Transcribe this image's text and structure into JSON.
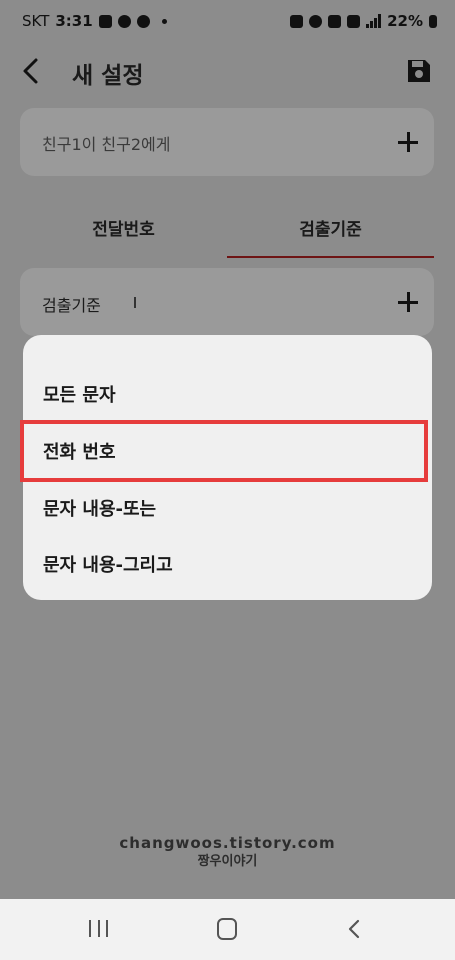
{
  "status_bar": {
    "carrier": "SKT",
    "time": "3:31",
    "battery": "22%"
  },
  "app_bar": {
    "title": "새 설정",
    "back_icon": "chevron-left-icon",
    "save_icon": "floppy-disk-icon"
  },
  "recipient": {
    "text": "친구1이 친구2에게",
    "add_icon": "plus-icon"
  },
  "tabs": [
    {
      "label": "전달번호",
      "active": false
    },
    {
      "label": "검출기준",
      "active": true
    }
  ],
  "criteria": {
    "label": "검출기준",
    "add_icon": "plus-icon"
  },
  "menu": {
    "items": [
      {
        "label": "모든 문자"
      },
      {
        "label": "전화 번호",
        "highlighted": true
      },
      {
        "label": "문자 내용-또는"
      },
      {
        "label": "문자 내용-그리고"
      }
    ]
  },
  "watermark": {
    "line1": "changwoos.tistory.com",
    "line2": "짱우이야기"
  },
  "nav_bar": {
    "recent_icon": "recent-apps-icon",
    "home_icon": "home-icon",
    "back_icon": "back-icon"
  },
  "colors": {
    "dim_background": "#8c8c8c",
    "menu_background": "#f0f0f0",
    "highlight_border": "#e63c3c",
    "tab_indicator": "#6e1414"
  }
}
